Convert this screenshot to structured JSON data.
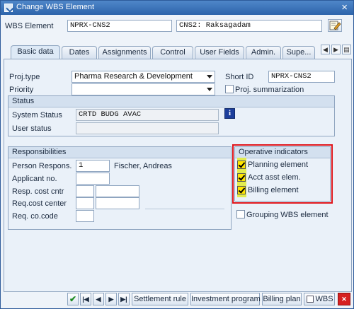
{
  "window": {
    "title": "Change WBS Element",
    "close_label": "×"
  },
  "header": {
    "wbs_label": "WBS Element",
    "wbs_value": "NPRX-CNS2",
    "description_value": "CNS2: Raksagadam"
  },
  "tabs": [
    {
      "label": "Basic data"
    },
    {
      "label": "Dates"
    },
    {
      "label": "Assignments"
    },
    {
      "label": "Control"
    },
    {
      "label": "User Fields"
    },
    {
      "label": "Admin."
    },
    {
      "label": "Supe..."
    }
  ],
  "tab_nav": {
    "left": "◀",
    "right": "▶",
    "menu": "▤"
  },
  "basic": {
    "proj_type_label": "Proj.type",
    "proj_type_value": "Pharma Research & Development",
    "priority_label": "Priority",
    "priority_value": "",
    "short_id_label": "Short ID",
    "short_id_value": "NPRX-CNS2",
    "proj_summ_label": "Proj. summarization"
  },
  "status": {
    "title": "Status",
    "system_label": "System Status",
    "system_value": "CRTD BUDG AVAC",
    "user_label": "User status",
    "user_value": "",
    "info_glyph": "i"
  },
  "responsibilities": {
    "title": "Responsibilities",
    "person_label": "Person Respons.",
    "person_value": "1",
    "person_name": "Fischer, Andreas",
    "applicant_label": "Applicant no.",
    "resp_cc_label": "Resp. cost cntr",
    "req_cc_label": "Req.cost center",
    "req_co_label": "Req. co.code"
  },
  "operative": {
    "title": "Operative indicators",
    "planning_label": "Planning element",
    "acct_label": "Acct asst elem.",
    "billing_label": "Billing element",
    "planning_checked": true,
    "acct_checked": true,
    "billing_checked": true
  },
  "grouping_label": "Grouping WBS element",
  "toolbar": {
    "ok": "✔",
    "first": "|◀",
    "prev": "◀",
    "next": "▶",
    "last": "▶|",
    "settlement": "Settlement rule",
    "investment": "Investment program",
    "billing_plan": "Billing plan",
    "wbs": "WBS",
    "cancel": "✕"
  },
  "colors": {
    "highlight_border": "#e0151b",
    "checkbox_fill": "#ffe600",
    "title_bar": "#2d64ab"
  }
}
